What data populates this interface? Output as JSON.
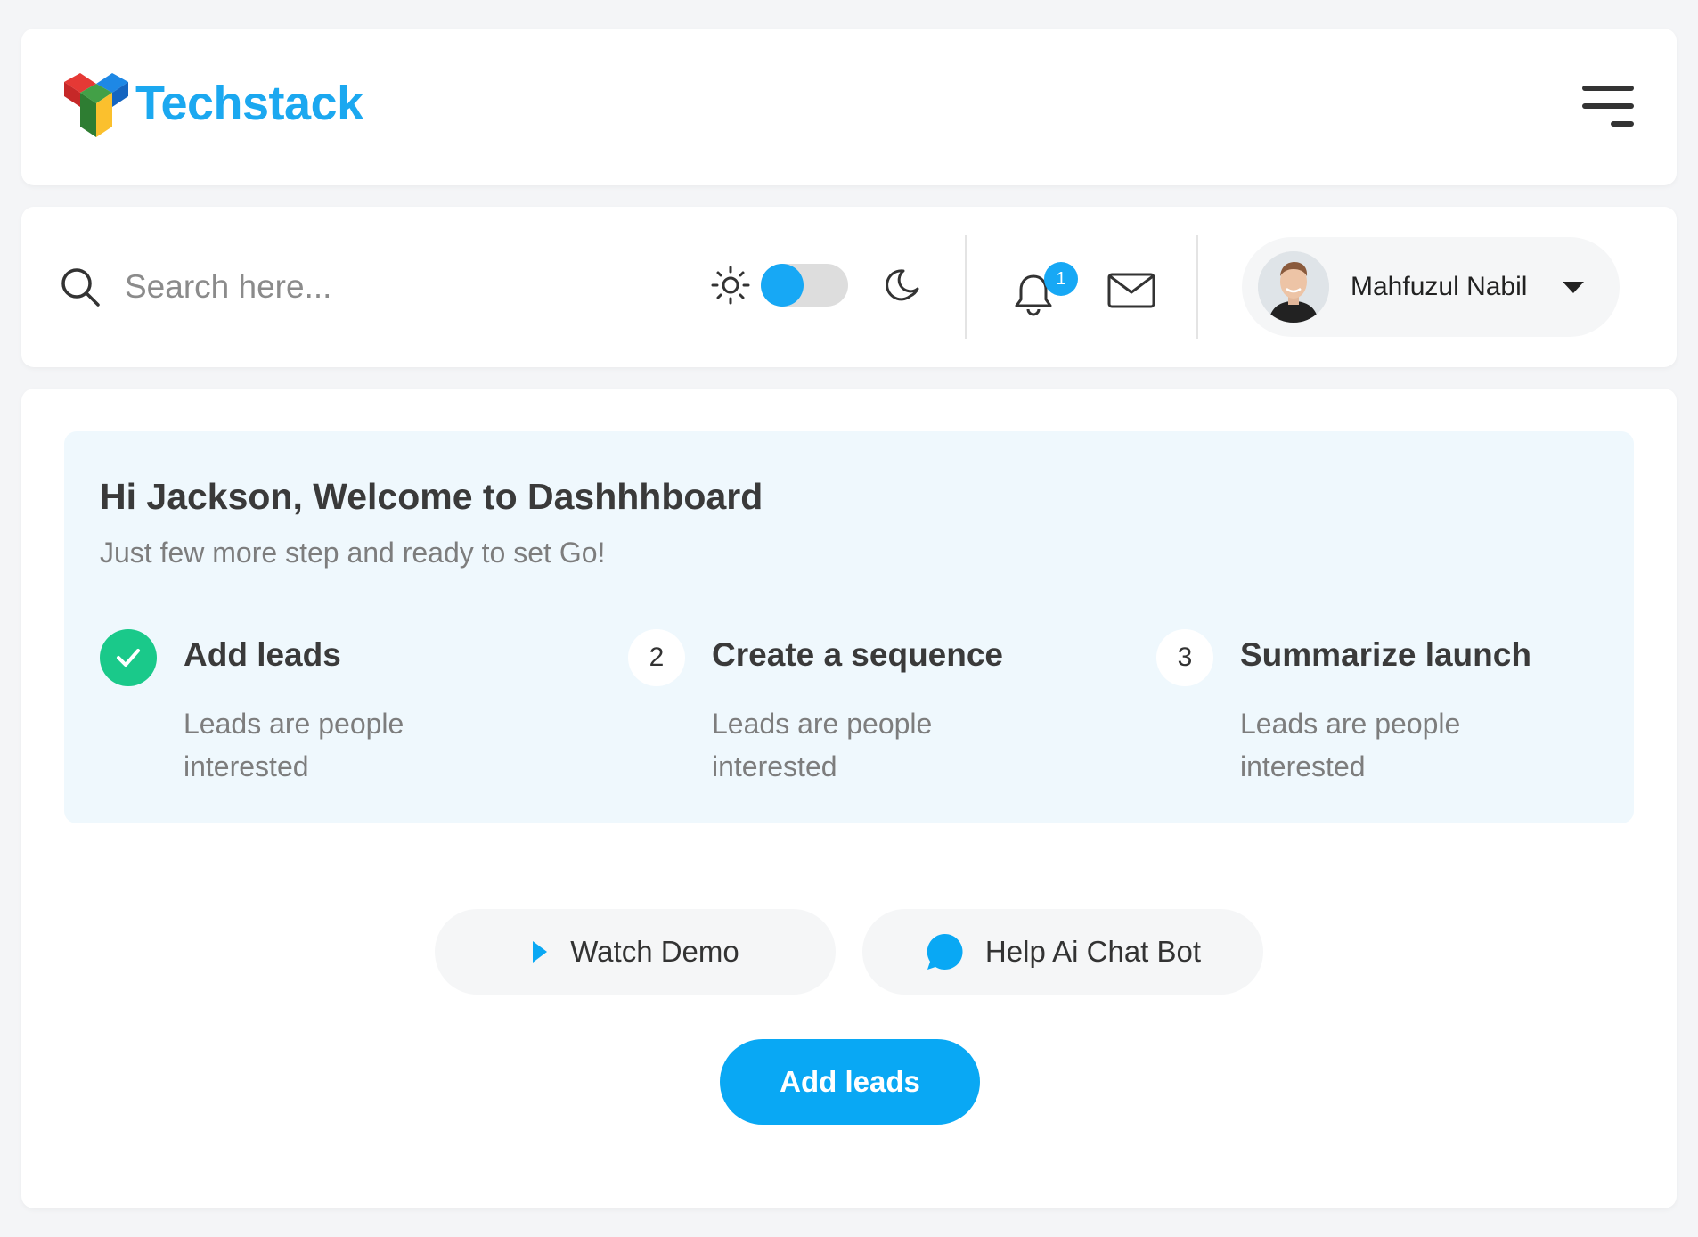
{
  "brand": {
    "name": "Techstack"
  },
  "search": {
    "placeholder": "Search here..."
  },
  "theme_toggle": {
    "mode": "light"
  },
  "notifications": {
    "count": "1"
  },
  "user": {
    "name": "Mahfuzul Nabil"
  },
  "welcome": {
    "title": "Hi Jackson, Welcome to Dashhhboard",
    "subtitle": "Just few more step and ready to set Go!"
  },
  "steps": [
    {
      "number": "",
      "status": "done",
      "title": "Add leads",
      "description": "Leads are people interested"
    },
    {
      "number": "2",
      "status": "pending",
      "title": "Create a sequence",
      "description": "Leads are people interested"
    },
    {
      "number": "3",
      "status": "pending",
      "title": "Summarize launch",
      "description": "Leads are people interested"
    }
  ],
  "actions": {
    "watch_demo": "Watch Demo",
    "chat_bot": "Help Ai Chat Bot",
    "primary": "Add leads"
  },
  "colors": {
    "accent": "#09a8f4",
    "success": "#1ac98a",
    "panel": "#eff8fd"
  }
}
